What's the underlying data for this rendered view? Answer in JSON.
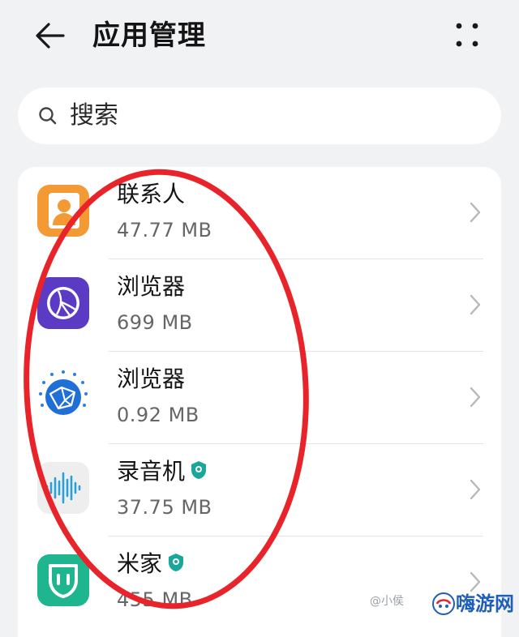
{
  "header": {
    "title": "应用管理",
    "back_icon": "back-arrow-icon",
    "more_icon": "more-dots-icon"
  },
  "search": {
    "placeholder": "搜索",
    "icon": "search-icon"
  },
  "apps": [
    {
      "name": "联系人",
      "size": "47.77 MB",
      "icon": "contacts-icon",
      "badge": false
    },
    {
      "name": "浏览器",
      "size": "699 MB",
      "icon": "browser-purple-icon",
      "badge": false
    },
    {
      "name": "浏览器",
      "size": "0.92 MB",
      "icon": "browser-blue-icon",
      "badge": false
    },
    {
      "name": "录音机",
      "size": "37.75 MB",
      "icon": "recorder-icon",
      "badge": true
    },
    {
      "name": "米家",
      "size": "455 MB",
      "icon": "mijia-icon",
      "badge": true
    }
  ],
  "watermark": {
    "text": "@小侯",
    "logo_text": "嗨游网"
  },
  "colors": {
    "background": "#f1f2f4",
    "card": "#ffffff",
    "annotation_red": "#e8242a",
    "badge_teal": "#1aa79a",
    "logo_blue": "#1f5fb8"
  }
}
